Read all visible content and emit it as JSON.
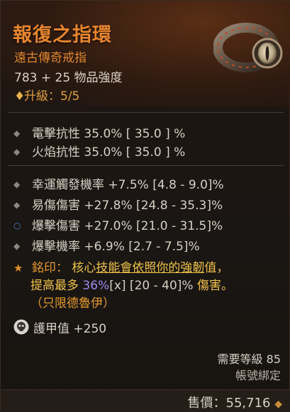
{
  "item": {
    "name": "報復之指環",
    "type": "遠古傳奇戒指",
    "item_power": "783 + 25 物品強度",
    "upgrade": "升級：5/5",
    "upgrade_icon": "diamond-icon"
  },
  "implicit_stats": [
    {
      "text": "電擊抗性 35.0%   [ 35.0 ] %"
    },
    {
      "text": "火焰抗性 35.0%   [ 35.0 ] %"
    }
  ],
  "affixes": [
    {
      "text": "幸運觸發機率 +7.5% [4.8 - 9.0]%"
    },
    {
      "text": "易傷傷害 +27.8% [24.8 - 35.3]%"
    },
    {
      "text": "爆擊傷害 +27.0% [21.0 - 31.5]%",
      "bullet": "blue"
    },
    {
      "text": "爆擊機率 +6.9% [2.7 - 7.5]%"
    }
  ],
  "aspect": {
    "prefix": "銘印：",
    "part1": "核心",
    "part2": "技能會依照你的",
    "part3": "強韌",
    "part4": "值，",
    "part5": "提高最多 ",
    "percent": "36%",
    "bracket": "[x] [20 - 40]%",
    "part6": " 傷害。",
    "class_note": "（只限德魯伊）"
  },
  "armor": {
    "text": "護甲值 +250",
    "icon": "skull-icon"
  },
  "requirements": {
    "level": "需要等級 85",
    "binding": "帳號綁定"
  },
  "price": {
    "text": "售價：55,716",
    "icon": "gold-coin-icon"
  },
  "colors": {
    "legendary_orange": "#e8852e",
    "stat_text": "#d6d0c4",
    "aspect_highlight": "#f0c34a",
    "percent_purple": "#9a8cf0"
  }
}
